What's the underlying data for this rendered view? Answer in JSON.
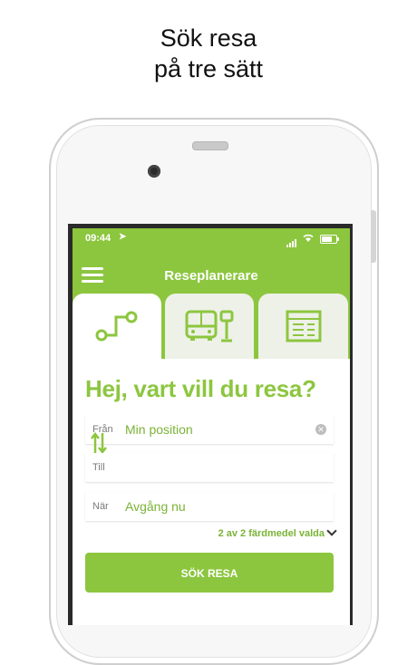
{
  "headline": {
    "line1": "Sök resa",
    "line2": "på tre sätt"
  },
  "status_bar": {
    "time": "09:44"
  },
  "nav": {
    "title": "Reseplanerare"
  },
  "tabs": [
    {
      "icon": "route-icon"
    },
    {
      "icon": "bus-stop-icon"
    },
    {
      "icon": "timetable-icon"
    }
  ],
  "main": {
    "greeting": "Hej, vart vill du resa?",
    "from": {
      "label": "Från",
      "value": "Min position"
    },
    "to": {
      "label": "Till",
      "value": ""
    },
    "when": {
      "label": "När",
      "value": "Avgång nu"
    },
    "modes_selector": "2 av 2 färdmedel valda",
    "search_button": "SÖK RESA"
  },
  "colors": {
    "accent": "#8cc63f",
    "text_green": "#7ab336",
    "tab_inactive": "#eef1e8"
  }
}
